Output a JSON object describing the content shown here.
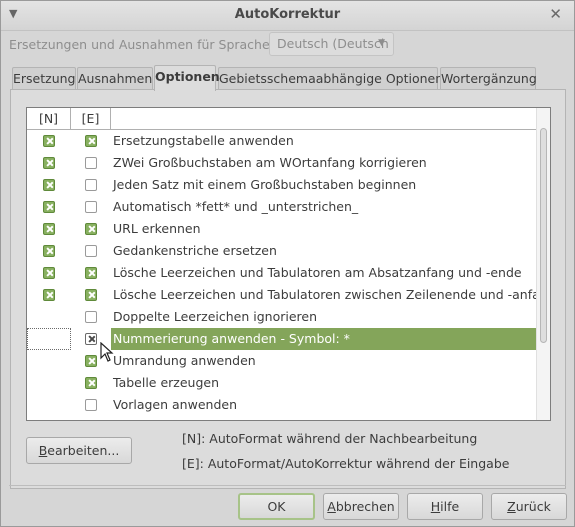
{
  "window": {
    "title": "AutoKorrektur"
  },
  "language": {
    "label": "Ersetzungen und Ausnahmen für Sprache:",
    "value": "Deutsch (Deutsch"
  },
  "tabs": [
    {
      "label": "Ersetzung",
      "active": false
    },
    {
      "label": "Ausnahmen",
      "active": false
    },
    {
      "label": "Optionen",
      "active": true
    },
    {
      "label": "Gebietsschemaabhängige Optionen",
      "active": false
    },
    {
      "label": "Wortergänzung",
      "active": false
    }
  ],
  "options": {
    "header_n": "[N]",
    "header_e": "[E]",
    "rows": [
      {
        "n": true,
        "e": true,
        "label": "Ersetzungstabelle anwenden"
      },
      {
        "n": true,
        "e": false,
        "label": "ZWei Großbuchstaben am WOrtanfang korrigieren"
      },
      {
        "n": true,
        "e": false,
        "label": "Jeden Satz mit einem Großbuchstaben beginnen"
      },
      {
        "n": true,
        "e": false,
        "label": "Automatisch *fett* und _unterstrichen_"
      },
      {
        "n": true,
        "e": true,
        "label": "URL erkennen"
      },
      {
        "n": true,
        "e": false,
        "label": "Gedankenstriche ersetzen"
      },
      {
        "n": true,
        "e": true,
        "label": "Lösche Leerzeichen und Tabulatoren am Absatzanfang und -ende"
      },
      {
        "n": true,
        "e": true,
        "label": "Lösche Leerzeichen und Tabulatoren zwischen Zeilenende und -anfang"
      },
      {
        "n": null,
        "e": false,
        "label": "Doppelte Leerzeichen ignorieren"
      },
      {
        "n": null,
        "e": true,
        "label": "Nummerierung anwenden - Symbol: *",
        "selected": true
      },
      {
        "n": null,
        "e": true,
        "label": "Umrandung anwenden"
      },
      {
        "n": null,
        "e": true,
        "label": "Tabelle erzeugen"
      },
      {
        "n": null,
        "e": false,
        "label": "Vorlagen anwenden"
      }
    ]
  },
  "edit_button": {
    "label_u": "B",
    "label_rest": "earbeiten..."
  },
  "legend": {
    "n": "[N]: AutoFormat während der Nachbearbeitung",
    "e": "[E]: AutoFormat/AutoKorrektur während der Eingabe"
  },
  "buttons": {
    "ok": "OK",
    "cancel_u": "A",
    "cancel_rest": "bbrechen",
    "help_u": "H",
    "help_rest": "ilfe",
    "reset_u": "Z",
    "reset_rest": "urück"
  },
  "colors": {
    "accent": "#84a55a",
    "checkbox": "#88b060"
  }
}
